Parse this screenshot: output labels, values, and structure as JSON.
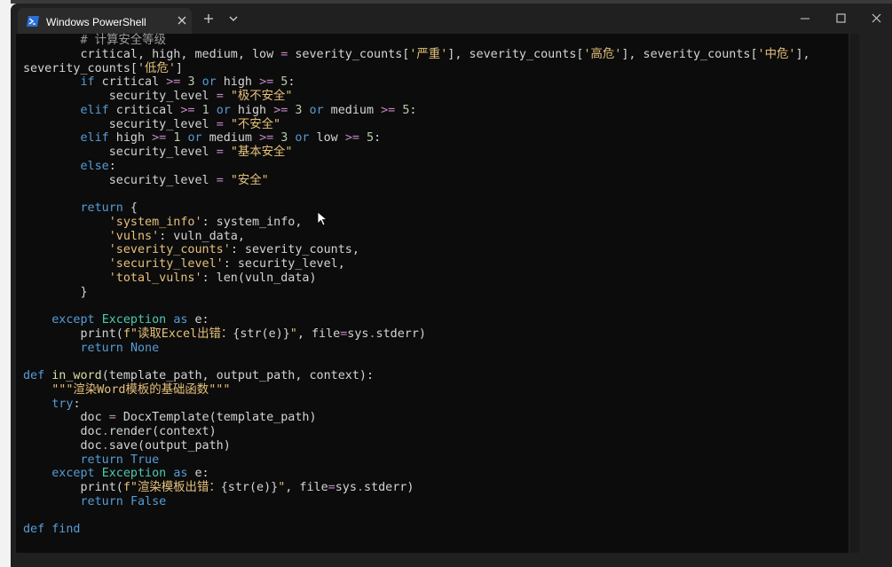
{
  "window": {
    "tab_title": "Windows PowerShell"
  },
  "editor": {
    "lines": [
      [
        {
          "t": "        "
        },
        {
          "t": "# 计算安全等级",
          "c": "cm"
        }
      ],
      [
        {
          "t": "        "
        },
        {
          "t": "critical, high, medium, low ",
          "c": "id"
        },
        {
          "t": "=",
          "c": "op"
        },
        {
          "t": " severity_counts[",
          "c": "id"
        },
        {
          "t": "'严重'",
          "c": "str"
        },
        {
          "t": "], severity_counts[",
          "c": "id"
        },
        {
          "t": "'高危'",
          "c": "str"
        },
        {
          "t": "], severity_counts[",
          "c": "id"
        },
        {
          "t": "'中危'",
          "c": "str"
        },
        {
          "t": "],",
          "c": "id"
        }
      ],
      [
        {
          "t": "severity_counts[",
          "c": "id"
        },
        {
          "t": "'低危'",
          "c": "str"
        },
        {
          "t": "]",
          "c": "id"
        }
      ],
      [
        {
          "t": "        "
        },
        {
          "t": "if",
          "c": "kw"
        },
        {
          "t": " critical ",
          "c": "id"
        },
        {
          "t": ">=",
          "c": "op"
        },
        {
          "t": " "
        },
        {
          "t": "3",
          "c": "num"
        },
        {
          "t": " "
        },
        {
          "t": "or",
          "c": "kw"
        },
        {
          "t": " high ",
          "c": "id"
        },
        {
          "t": ">=",
          "c": "op"
        },
        {
          "t": " "
        },
        {
          "t": "5",
          "c": "num"
        },
        {
          "t": ":",
          "c": "id"
        }
      ],
      [
        {
          "t": "            "
        },
        {
          "t": "security_level ",
          "c": "id"
        },
        {
          "t": "=",
          "c": "op"
        },
        {
          "t": " "
        },
        {
          "t": "\"极不安全\"",
          "c": "str"
        }
      ],
      [
        {
          "t": "        "
        },
        {
          "t": "elif",
          "c": "kw"
        },
        {
          "t": " critical ",
          "c": "id"
        },
        {
          "t": ">=",
          "c": "op"
        },
        {
          "t": " "
        },
        {
          "t": "1",
          "c": "num"
        },
        {
          "t": " "
        },
        {
          "t": "or",
          "c": "kw"
        },
        {
          "t": " high ",
          "c": "id"
        },
        {
          "t": ">=",
          "c": "op"
        },
        {
          "t": " "
        },
        {
          "t": "3",
          "c": "num"
        },
        {
          "t": " "
        },
        {
          "t": "or",
          "c": "kw"
        },
        {
          "t": " medium ",
          "c": "id"
        },
        {
          "t": ">=",
          "c": "op"
        },
        {
          "t": " "
        },
        {
          "t": "5",
          "c": "num"
        },
        {
          "t": ":",
          "c": "id"
        }
      ],
      [
        {
          "t": "            "
        },
        {
          "t": "security_level ",
          "c": "id"
        },
        {
          "t": "=",
          "c": "op"
        },
        {
          "t": " "
        },
        {
          "t": "\"不安全\"",
          "c": "str"
        }
      ],
      [
        {
          "t": "        "
        },
        {
          "t": "elif",
          "c": "kw"
        },
        {
          "t": " high ",
          "c": "id"
        },
        {
          "t": ">=",
          "c": "op"
        },
        {
          "t": " "
        },
        {
          "t": "1",
          "c": "num"
        },
        {
          "t": " "
        },
        {
          "t": "or",
          "c": "kw"
        },
        {
          "t": " medium ",
          "c": "id"
        },
        {
          "t": ">=",
          "c": "op"
        },
        {
          "t": " "
        },
        {
          "t": "3",
          "c": "num"
        },
        {
          "t": " "
        },
        {
          "t": "or",
          "c": "kw"
        },
        {
          "t": " low ",
          "c": "id"
        },
        {
          "t": ">=",
          "c": "op"
        },
        {
          "t": " "
        },
        {
          "t": "5",
          "c": "num"
        },
        {
          "t": ":",
          "c": "id"
        }
      ],
      [
        {
          "t": "            "
        },
        {
          "t": "security_level ",
          "c": "id"
        },
        {
          "t": "=",
          "c": "op"
        },
        {
          "t": " "
        },
        {
          "t": "\"基本安全\"",
          "c": "str"
        }
      ],
      [
        {
          "t": "        "
        },
        {
          "t": "else",
          "c": "kw"
        },
        {
          "t": ":",
          "c": "id"
        }
      ],
      [
        {
          "t": "            "
        },
        {
          "t": "security_level ",
          "c": "id"
        },
        {
          "t": "=",
          "c": "op"
        },
        {
          "t": " "
        },
        {
          "t": "\"安全\"",
          "c": "str"
        }
      ],
      [
        {
          "t": ""
        }
      ],
      [
        {
          "t": "        "
        },
        {
          "t": "return",
          "c": "kw"
        },
        {
          "t": " {",
          "c": "id"
        }
      ],
      [
        {
          "t": "            "
        },
        {
          "t": "'system_info'",
          "c": "str"
        },
        {
          "t": ": system_info,",
          "c": "id"
        }
      ],
      [
        {
          "t": "            "
        },
        {
          "t": "'vulns'",
          "c": "str"
        },
        {
          "t": ": vuln_data,",
          "c": "id"
        }
      ],
      [
        {
          "t": "            "
        },
        {
          "t": "'severity_counts'",
          "c": "str"
        },
        {
          "t": ": severity_counts,",
          "c": "id"
        }
      ],
      [
        {
          "t": "            "
        },
        {
          "t": "'security_level'",
          "c": "str"
        },
        {
          "t": ": security_level,",
          "c": "id"
        }
      ],
      [
        {
          "t": "            "
        },
        {
          "t": "'total_vulns'",
          "c": "str"
        },
        {
          "t": ": len(vuln_data)",
          "c": "id"
        }
      ],
      [
        {
          "t": "        "
        },
        {
          "t": "}",
          "c": "id"
        }
      ],
      [
        {
          "t": ""
        }
      ],
      [
        {
          "t": "    "
        },
        {
          "t": "except",
          "c": "kw"
        },
        {
          "t": " "
        },
        {
          "t": "Exception",
          "c": "kw2"
        },
        {
          "t": " "
        },
        {
          "t": "as",
          "c": "kw"
        },
        {
          "t": " e:",
          "c": "id"
        }
      ],
      [
        {
          "t": "        "
        },
        {
          "t": "print(",
          "c": "id"
        },
        {
          "t": "f\"读取Excel出错：",
          "c": "str"
        },
        {
          "t": "{str(e)}",
          "c": "id"
        },
        {
          "t": "\"",
          "c": "str"
        },
        {
          "t": ", file",
          "c": "id"
        },
        {
          "t": "=",
          "c": "op"
        },
        {
          "t": "sys",
          "c": "id"
        },
        {
          "t": ".",
          "c": "op"
        },
        {
          "t": "stderr)",
          "c": "id"
        }
      ],
      [
        {
          "t": "        "
        },
        {
          "t": "return",
          "c": "kw"
        },
        {
          "t": " "
        },
        {
          "t": "None",
          "c": "kw"
        }
      ],
      [
        {
          "t": ""
        }
      ],
      [
        {
          "t": "def",
          "c": "kw"
        },
        {
          "t": " "
        },
        {
          "t": "in_word",
          "c": "fn"
        },
        {
          "t": "(template_path, output_path, context):",
          "c": "id"
        }
      ],
      [
        {
          "t": "    "
        },
        {
          "t": "\"\"\"渲染Word模板的基础函数\"\"\"",
          "c": "str"
        }
      ],
      [
        {
          "t": "    "
        },
        {
          "t": "try",
          "c": "kw"
        },
        {
          "t": ":",
          "c": "id"
        }
      ],
      [
        {
          "t": "        "
        },
        {
          "t": "doc ",
          "c": "id"
        },
        {
          "t": "=",
          "c": "op"
        },
        {
          "t": " DocxTemplate(template_path)",
          "c": "id"
        }
      ],
      [
        {
          "t": "        "
        },
        {
          "t": "doc",
          "c": "id"
        },
        {
          "t": ".",
          "c": "op"
        },
        {
          "t": "render(context)",
          "c": "id"
        }
      ],
      [
        {
          "t": "        "
        },
        {
          "t": "doc",
          "c": "id"
        },
        {
          "t": ".",
          "c": "op"
        },
        {
          "t": "save(output_path)",
          "c": "id"
        }
      ],
      [
        {
          "t": "        "
        },
        {
          "t": "return",
          "c": "kw"
        },
        {
          "t": " "
        },
        {
          "t": "True",
          "c": "kw"
        }
      ],
      [
        {
          "t": "    "
        },
        {
          "t": "except",
          "c": "kw"
        },
        {
          "t": " "
        },
        {
          "t": "Exception",
          "c": "kw2"
        },
        {
          "t": " "
        },
        {
          "t": "as",
          "c": "kw"
        },
        {
          "t": " e:",
          "c": "id"
        }
      ],
      [
        {
          "t": "        "
        },
        {
          "t": "print(",
          "c": "id"
        },
        {
          "t": "f\"渲染模板出错：",
          "c": "str"
        },
        {
          "t": "{str(e)}",
          "c": "id"
        },
        {
          "t": "\"",
          "c": "str"
        },
        {
          "t": ", file",
          "c": "id"
        },
        {
          "t": "=",
          "c": "op"
        },
        {
          "t": "sys",
          "c": "id"
        },
        {
          "t": ".",
          "c": "op"
        },
        {
          "t": "stderr)",
          "c": "id"
        }
      ],
      [
        {
          "t": "        "
        },
        {
          "t": "return",
          "c": "kw"
        },
        {
          "t": " "
        },
        {
          "t": "False",
          "c": "kw"
        }
      ],
      [
        {
          "t": ""
        }
      ],
      [
        {
          "t": "def",
          "c": "kw"
        },
        {
          "t": " find",
          "c": "kw"
        }
      ]
    ]
  },
  "icons": {
    "tab_icon": "powershell-icon",
    "tab_close": "close-icon",
    "new_tab": "plus-icon",
    "dropdown": "chevron-down-icon",
    "minimize": "minimize-icon",
    "maximize": "maximize-icon",
    "close": "close-icon",
    "cursor": "mouse-pointer-icon"
  }
}
